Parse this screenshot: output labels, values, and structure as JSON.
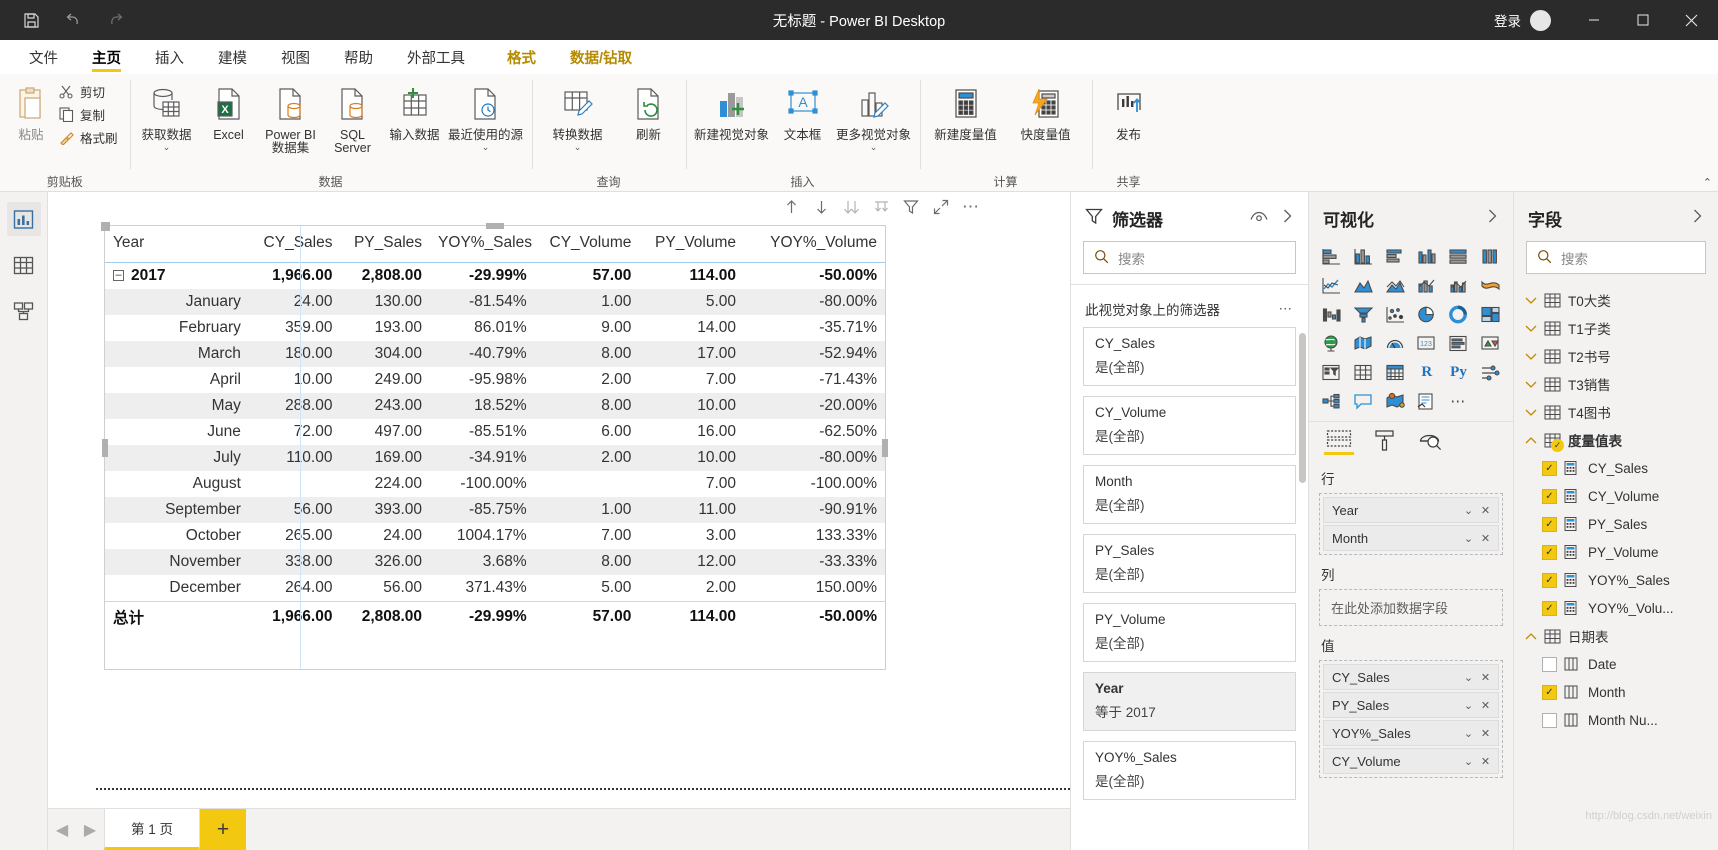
{
  "titlebar": {
    "title": "无标题 - Power BI Desktop",
    "save_icon": "save-icon",
    "undo_icon": "undo-icon",
    "redo_icon": "redo-icon",
    "signin_label": "登录",
    "minimize": "–",
    "maximize": "□",
    "close": "✕"
  },
  "ribbon": {
    "tabs": [
      {
        "label": "文件",
        "state": "normal"
      },
      {
        "label": "主页",
        "state": "active"
      },
      {
        "label": "插入",
        "state": "normal"
      },
      {
        "label": "建模",
        "state": "normal"
      },
      {
        "label": "视图",
        "state": "normal"
      },
      {
        "label": "帮助",
        "state": "normal"
      },
      {
        "label": "外部工具",
        "state": "normal"
      }
    ],
    "context_tabs": [
      {
        "label": "格式"
      },
      {
        "label": "数据/钻取"
      }
    ],
    "groups": [
      {
        "name": "剪贴板",
        "paste_label": "粘贴",
        "small": [
          {
            "label": "剪切",
            "icon": "scissors-icon"
          },
          {
            "label": "复制",
            "icon": "copy-icon"
          },
          {
            "label": "格式刷",
            "icon": "format-painter-icon"
          }
        ]
      },
      {
        "name": "数据",
        "buttons": [
          {
            "label": "获取数据",
            "icon": "get-data-icon",
            "has_chevron": true
          },
          {
            "label": "Excel",
            "icon": "excel-icon",
            "has_chevron": false
          },
          {
            "label": "Power BI 数据集",
            "icon": "powerbi-dataset-icon",
            "has_chevron": false
          },
          {
            "label": "SQL Server",
            "icon": "sql-server-icon",
            "has_chevron": false
          },
          {
            "label": "输入数据",
            "icon": "enter-data-icon",
            "has_chevron": false
          },
          {
            "label": "最近使用的源",
            "icon": "recent-sources-icon",
            "has_chevron": true
          }
        ]
      },
      {
        "name": "查询",
        "buttons": [
          {
            "label": "转换数据",
            "icon": "transform-data-icon",
            "has_chevron": true
          },
          {
            "label": "刷新",
            "icon": "refresh-icon",
            "has_chevron": false
          }
        ]
      },
      {
        "name": "插入",
        "buttons": [
          {
            "label": "新建视觉对象",
            "icon": "new-visual-icon",
            "has_chevron": false
          },
          {
            "label": "文本框",
            "icon": "text-box-icon",
            "has_chevron": false
          },
          {
            "label": "更多视觉对象",
            "icon": "more-visuals-icon",
            "has_chevron": true
          }
        ]
      },
      {
        "name": "计算",
        "buttons": [
          {
            "label": "新建度量值",
            "icon": "new-measure-icon",
            "has_chevron": false
          },
          {
            "label": "快度量值",
            "icon": "quick-measure-icon",
            "has_chevron": false
          }
        ]
      },
      {
        "name": "共享",
        "buttons": [
          {
            "label": "发布",
            "icon": "publish-icon",
            "has_chevron": false
          }
        ]
      }
    ]
  },
  "viewrail": [
    {
      "name": "report-view",
      "icon": "report-icon",
      "active": true
    },
    {
      "name": "data-view",
      "icon": "table-icon",
      "active": false
    },
    {
      "name": "model-view",
      "icon": "model-icon",
      "active": false
    }
  ],
  "visual_toolbar": [
    {
      "name": "drill-up",
      "icon": "arrow-up-icon"
    },
    {
      "name": "drill-down-toggle",
      "icon": "arrow-down-icon"
    },
    {
      "name": "expand-all-down",
      "icon": "double-arrow-down-icon"
    },
    {
      "name": "go-to-next-level",
      "icon": "level-down-icon"
    },
    {
      "name": "filter",
      "icon": "funnel-icon"
    },
    {
      "name": "focus-mode",
      "icon": "expand-icon"
    },
    {
      "name": "more-options",
      "icon": "ellipsis-icon"
    }
  ],
  "chart_data": {
    "type": "table",
    "title": "",
    "columns": [
      "Year",
      "CY_Sales",
      "PY_Sales",
      "YOY%_Sales",
      "CY_Volume",
      "PY_Volume",
      "YOY%_Volume"
    ],
    "rows": [
      {
        "label": "2017",
        "kind": "subtotal",
        "expandable": true,
        "expander": "–",
        "values": [
          "1,966.00",
          "2,808.00",
          "-29.99%",
          "57.00",
          "114.00",
          "-50.00%"
        ]
      },
      {
        "label": "January",
        "kind": "child",
        "values": [
          "24.00",
          "130.00",
          "-81.54%",
          "1.00",
          "5.00",
          "-80.00%"
        ]
      },
      {
        "label": "February",
        "kind": "child",
        "values": [
          "359.00",
          "193.00",
          "86.01%",
          "9.00",
          "14.00",
          "-35.71%"
        ]
      },
      {
        "label": "March",
        "kind": "child",
        "values": [
          "180.00",
          "304.00",
          "-40.79%",
          "8.00",
          "17.00",
          "-52.94%"
        ]
      },
      {
        "label": "April",
        "kind": "child",
        "values": [
          "10.00",
          "249.00",
          "-95.98%",
          "2.00",
          "7.00",
          "-71.43%"
        ]
      },
      {
        "label": "May",
        "kind": "child",
        "values": [
          "288.00",
          "243.00",
          "18.52%",
          "8.00",
          "10.00",
          "-20.00%"
        ]
      },
      {
        "label": "June",
        "kind": "child",
        "values": [
          "72.00",
          "497.00",
          "-85.51%",
          "6.00",
          "16.00",
          "-62.50%"
        ]
      },
      {
        "label": "July",
        "kind": "child",
        "values": [
          "110.00",
          "169.00",
          "-34.91%",
          "2.00",
          "10.00",
          "-80.00%"
        ]
      },
      {
        "label": "August",
        "kind": "child",
        "values": [
          "",
          "224.00",
          "-100.00%",
          "",
          "7.00",
          "-100.00%"
        ]
      },
      {
        "label": "September",
        "kind": "child",
        "values": [
          "56.00",
          "393.00",
          "-85.75%",
          "1.00",
          "11.00",
          "-90.91%"
        ]
      },
      {
        "label": "October",
        "kind": "child",
        "values": [
          "265.00",
          "24.00",
          "1004.17%",
          "7.00",
          "3.00",
          "133.33%"
        ]
      },
      {
        "label": "November",
        "kind": "child",
        "values": [
          "338.00",
          "326.00",
          "3.68%",
          "8.00",
          "12.00",
          "-33.33%"
        ]
      },
      {
        "label": "December",
        "kind": "child",
        "values": [
          "264.00",
          "56.00",
          "371.43%",
          "5.00",
          "2.00",
          "150.00%"
        ]
      },
      {
        "label": "总计",
        "kind": "grandtotal",
        "values": [
          "1,966.00",
          "2,808.00",
          "-29.99%",
          "57.00",
          "114.00",
          "-50.00%"
        ]
      }
    ]
  },
  "pagebar": {
    "prev": "◀",
    "next": "▶",
    "tabs": [
      {
        "label": "第 1 页",
        "active": true
      }
    ],
    "add_label": "+"
  },
  "filters": {
    "title": "筛选器",
    "eye_icon": "eye-icon",
    "collapse_icon": "chevron-right-icon",
    "search_placeholder": "搜索",
    "section_label": "此视觉对象上的筛选器",
    "more_icon": "ellipsis-icon",
    "cards": [
      {
        "name": "CY_Sales",
        "value": "是(全部)",
        "applied": false
      },
      {
        "name": "CY_Volume",
        "value": "是(全部)",
        "applied": false
      },
      {
        "name": "Month",
        "value": "是(全部)",
        "applied": false
      },
      {
        "name": "PY_Sales",
        "value": "是(全部)",
        "applied": false
      },
      {
        "name": "PY_Volume",
        "value": "是(全部)",
        "applied": false
      },
      {
        "name": "Year",
        "value": "等于 2017",
        "applied": true
      },
      {
        "name": "YOY%_Sales",
        "value": "是(全部)",
        "applied": false
      }
    ]
  },
  "visualizations": {
    "title": "可视化",
    "collapse_icon": "chevron-right-icon",
    "icons": [
      "stacked-bar-chart-icon",
      "stacked-column-chart-icon",
      "clustered-bar-chart-icon",
      "clustered-column-chart-icon",
      "100-stacked-bar-chart-icon",
      "100-stacked-column-chart-icon",
      "line-chart-icon",
      "area-chart-icon",
      "stacked-area-chart-icon",
      "line-stacked-column-icon",
      "line-clustered-column-icon",
      "ribbon-chart-icon",
      "waterfall-chart-icon",
      "funnel-chart-icon",
      "scatter-chart-icon",
      "pie-chart-icon",
      "donut-chart-icon",
      "treemap-icon",
      "map-icon",
      "filled-map-icon",
      "gauge-icon",
      "card-icon",
      "multi-row-card-icon",
      "kpi-icon",
      "slicer-icon",
      "table-icon",
      "matrix-icon",
      "r-visual-icon",
      "python-visual-icon",
      "key-influencers-icon",
      "decomposition-tree-icon",
      "smart-narrative-icon",
      "arcgis-map-icon",
      "paginated-report-icon",
      "more-visuals-ellipsis-icon"
    ],
    "format_tabs": [
      {
        "name": "fields-tab",
        "icon": "fields-well-icon",
        "active": true
      },
      {
        "name": "format-tab",
        "icon": "paint-roller-icon",
        "active": false
      },
      {
        "name": "analytics-tab",
        "icon": "magnifier-chart-icon",
        "active": false
      }
    ],
    "wells": [
      {
        "label": "行",
        "items": [
          {
            "name": "Year"
          },
          {
            "name": "Month"
          }
        ],
        "empty_text": null
      },
      {
        "label": "列",
        "items": [],
        "empty_text": "在此处添加数据字段"
      },
      {
        "label": "值",
        "items": [
          {
            "name": "CY_Sales"
          },
          {
            "name": "PY_Sales"
          },
          {
            "name": "YOY%_Sales"
          },
          {
            "name": "CY_Volume"
          }
        ],
        "empty_text": null
      }
    ]
  },
  "fields": {
    "title": "字段",
    "collapse_icon": "chevron-right-icon",
    "search_placeholder": "搜索",
    "tables": [
      {
        "name": "T0大类",
        "expanded": false,
        "children": []
      },
      {
        "name": "T1子类",
        "expanded": false,
        "children": []
      },
      {
        "name": "T2书号",
        "expanded": false,
        "children": []
      },
      {
        "name": "T3销售",
        "expanded": false,
        "children": []
      },
      {
        "name": "T4图书",
        "expanded": false,
        "children": []
      },
      {
        "name": "度量值表",
        "expanded": true,
        "is_measure_table": true,
        "children": [
          {
            "name": "CY_Sales",
            "checked": true,
            "icon": "measure-icon"
          },
          {
            "name": "CY_Volume",
            "checked": true,
            "icon": "measure-icon"
          },
          {
            "name": "PY_Sales",
            "checked": true,
            "icon": "measure-icon"
          },
          {
            "name": "PY_Volume",
            "checked": true,
            "icon": "measure-icon"
          },
          {
            "name": "YOY%_Sales",
            "checked": true,
            "icon": "measure-icon"
          },
          {
            "name": "YOY%_Volu...",
            "checked": true,
            "icon": "measure-icon"
          }
        ]
      },
      {
        "name": "日期表",
        "expanded": true,
        "children": [
          {
            "name": "Date",
            "checked": false,
            "icon": "column-icon"
          },
          {
            "name": "Month",
            "checked": true,
            "icon": "column-icon"
          },
          {
            "name": "Month Nu...",
            "checked": false,
            "icon": "column-icon"
          }
        ]
      }
    ]
  },
  "watermark": "http://blog.csdn.net/weixin"
}
